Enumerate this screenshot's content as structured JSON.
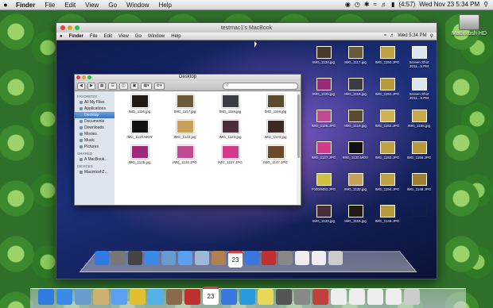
{
  "menubar": {
    "apple_icon": "",
    "app": "Finder",
    "items": [
      "File",
      "Edit",
      "View",
      "Go",
      "Window",
      "Help"
    ],
    "battery": "(4:57)",
    "clock": "Wed Nov 23  5:34 PM"
  },
  "desktop": {
    "hd_label": "Macintosh HD"
  },
  "vm": {
    "title": "testmac1's MacBook",
    "menubar": {
      "app": "Finder",
      "items": [
        "File",
        "Edit",
        "View",
        "Go",
        "Window",
        "Help"
      ],
      "clock": "Wed 5:34 PM"
    },
    "finder": {
      "title": "Desktop",
      "search_placeholder": "",
      "sidebar": {
        "favorites_head": "FAVORITES",
        "favorites": [
          "All My Files",
          "Applications",
          "Desktop",
          "Documents",
          "Downloads",
          "Movies",
          "Music",
          "Pictures"
        ],
        "shared_head": "SHARED",
        "shared": [
          "A MacBook..."
        ],
        "devices_head": "DEVICES",
        "devices": [
          "Macintosh2..."
        ]
      },
      "files": [
        {
          "name": "IMG_1116.jpg",
          "color": "#201a14"
        },
        {
          "name": "IMG_1117.jpg",
          "color": "#6b5a3a"
        },
        {
          "name": "IMG_1118.jpg",
          "color": "#3a3c45"
        },
        {
          "name": "IMG_1119.jpg",
          "color": "#5a4a30"
        },
        {
          "name": "IMG_1120.MOV",
          "color": "#111111"
        },
        {
          "name": "IMG_1122.jpg",
          "color": "#c8a058"
        },
        {
          "name": "IMG_1123.jpg",
          "color": "#4b2c3a"
        },
        {
          "name": "IMG_1124.jpg",
          "color": "#3a2a22"
        },
        {
          "name": "IMG_1125.jpg",
          "color": "#a02a7a"
        },
        {
          "name": "IMG_1126.JPG",
          "color": "#c24a90"
        },
        {
          "name": "IMG_1127.JPG",
          "color": "#d23a8a"
        },
        {
          "name": "IMG_1147.JPG",
          "color": "#6a4a2a"
        }
      ]
    },
    "desk_files": [
      {
        "name": "IMG_1124.jpg",
        "color": "#4a3a2a"
      },
      {
        "name": "IMG_1117.jpg",
        "color": "#6b5a3a"
      },
      {
        "name": "IMG_1150.JPG",
        "color": "#c0a040"
      },
      {
        "name": "Screen Shot 2011...5 PM",
        "color": "#dfe6ef"
      },
      {
        "name": "IMG_1125.jpg",
        "color": "#9a2a7a"
      },
      {
        "name": "IMG_1118.jpg",
        "color": "#3a3c45"
      },
      {
        "name": "IMG_1151.JPG",
        "color": "#b89a3a"
      },
      {
        "name": "Screen Shot 2011...6 PM",
        "color": "#dfe6ef"
      },
      {
        "name": "IMG_1126.JPG",
        "color": "#c24a90"
      },
      {
        "name": "IMG_1119.jpg",
        "color": "#5a4a30"
      },
      {
        "name": "IMG_1152.JPG",
        "color": "#d0b050"
      },
      {
        "name": "IMG_1155.jpg",
        "color": "#c8a848"
      },
      {
        "name": "IMG_1127.JPG",
        "color": "#d23a8a"
      },
      {
        "name": "IMG_1120.MOV",
        "color": "#111111"
      },
      {
        "name": "IMG_1153.JPG",
        "color": "#c0a040"
      },
      {
        "name": "IMG_1156.JPG",
        "color": "#b8983a"
      },
      {
        "name": "P1010451.JPG",
        "color": "#d0c040"
      },
      {
        "name": "IMG_1122.jpg",
        "color": "#c8a058"
      },
      {
        "name": "IMG_1154.JPG",
        "color": "#c0a040"
      },
      {
        "name": "IMG_1148.JPG",
        "color": "#a08030"
      },
      {
        "name": "IMG_1123.jpg",
        "color": "#4b2c3a"
      },
      {
        "name": "IMG_1116.jpg",
        "color": "#201a14"
      },
      {
        "name": "IMG_1149.JPG",
        "color": "#b89a3a"
      },
      {
        "name": "",
        "color": "transparent"
      }
    ],
    "dock_icons": [
      "finder-icon",
      "launchpad-icon",
      "mission-control-icon",
      "appstore-icon",
      "preview-icon",
      "safari-icon",
      "mail-icon",
      "contacts-icon",
      "calendar-icon",
      "itunes-icon",
      "photobooth-icon",
      "system-prefs-icon",
      "document-icon",
      "document-icon",
      "trash-icon"
    ],
    "dock_colors": [
      "#2f7be0",
      "#777",
      "#444",
      "#3a8be8",
      "#6a9bd0",
      "#5aa0f0",
      "#a0b8d8",
      "#b08050",
      "#e04040",
      "#3a78e0",
      "#c03030",
      "#888",
      "#eee",
      "#eee",
      "#ccc"
    ],
    "calendar_day": "23"
  },
  "dock": {
    "icons": [
      "finder-icon",
      "appstore-icon",
      "preview-icon",
      "notes-icon",
      "safari-icon",
      "chrome-icon",
      "tweetbot-icon",
      "photos-icon",
      "photobooth-icon",
      "calendar-icon",
      "itunes-icon",
      "skype-icon",
      "stickies-icon",
      "utility-icon",
      "system-prefs-icon",
      "dictionary-icon",
      "document-icon",
      "document-icon",
      "document-icon",
      "document-icon",
      "trash-icon"
    ],
    "colors": [
      "#2f7be0",
      "#3a8be8",
      "#6a9bd0",
      "#d0b070",
      "#5aa0f0",
      "#e0c030",
      "#55b0e8",
      "#8a6a4a",
      "#c03030",
      "#e04040",
      "#3a78e0",
      "#2a9ae0",
      "#e8d85a",
      "#555",
      "#888",
      "#c04040",
      "#eee",
      "#eee",
      "#eee",
      "#eee",
      "#ccc"
    ],
    "calendar_day": "23"
  }
}
